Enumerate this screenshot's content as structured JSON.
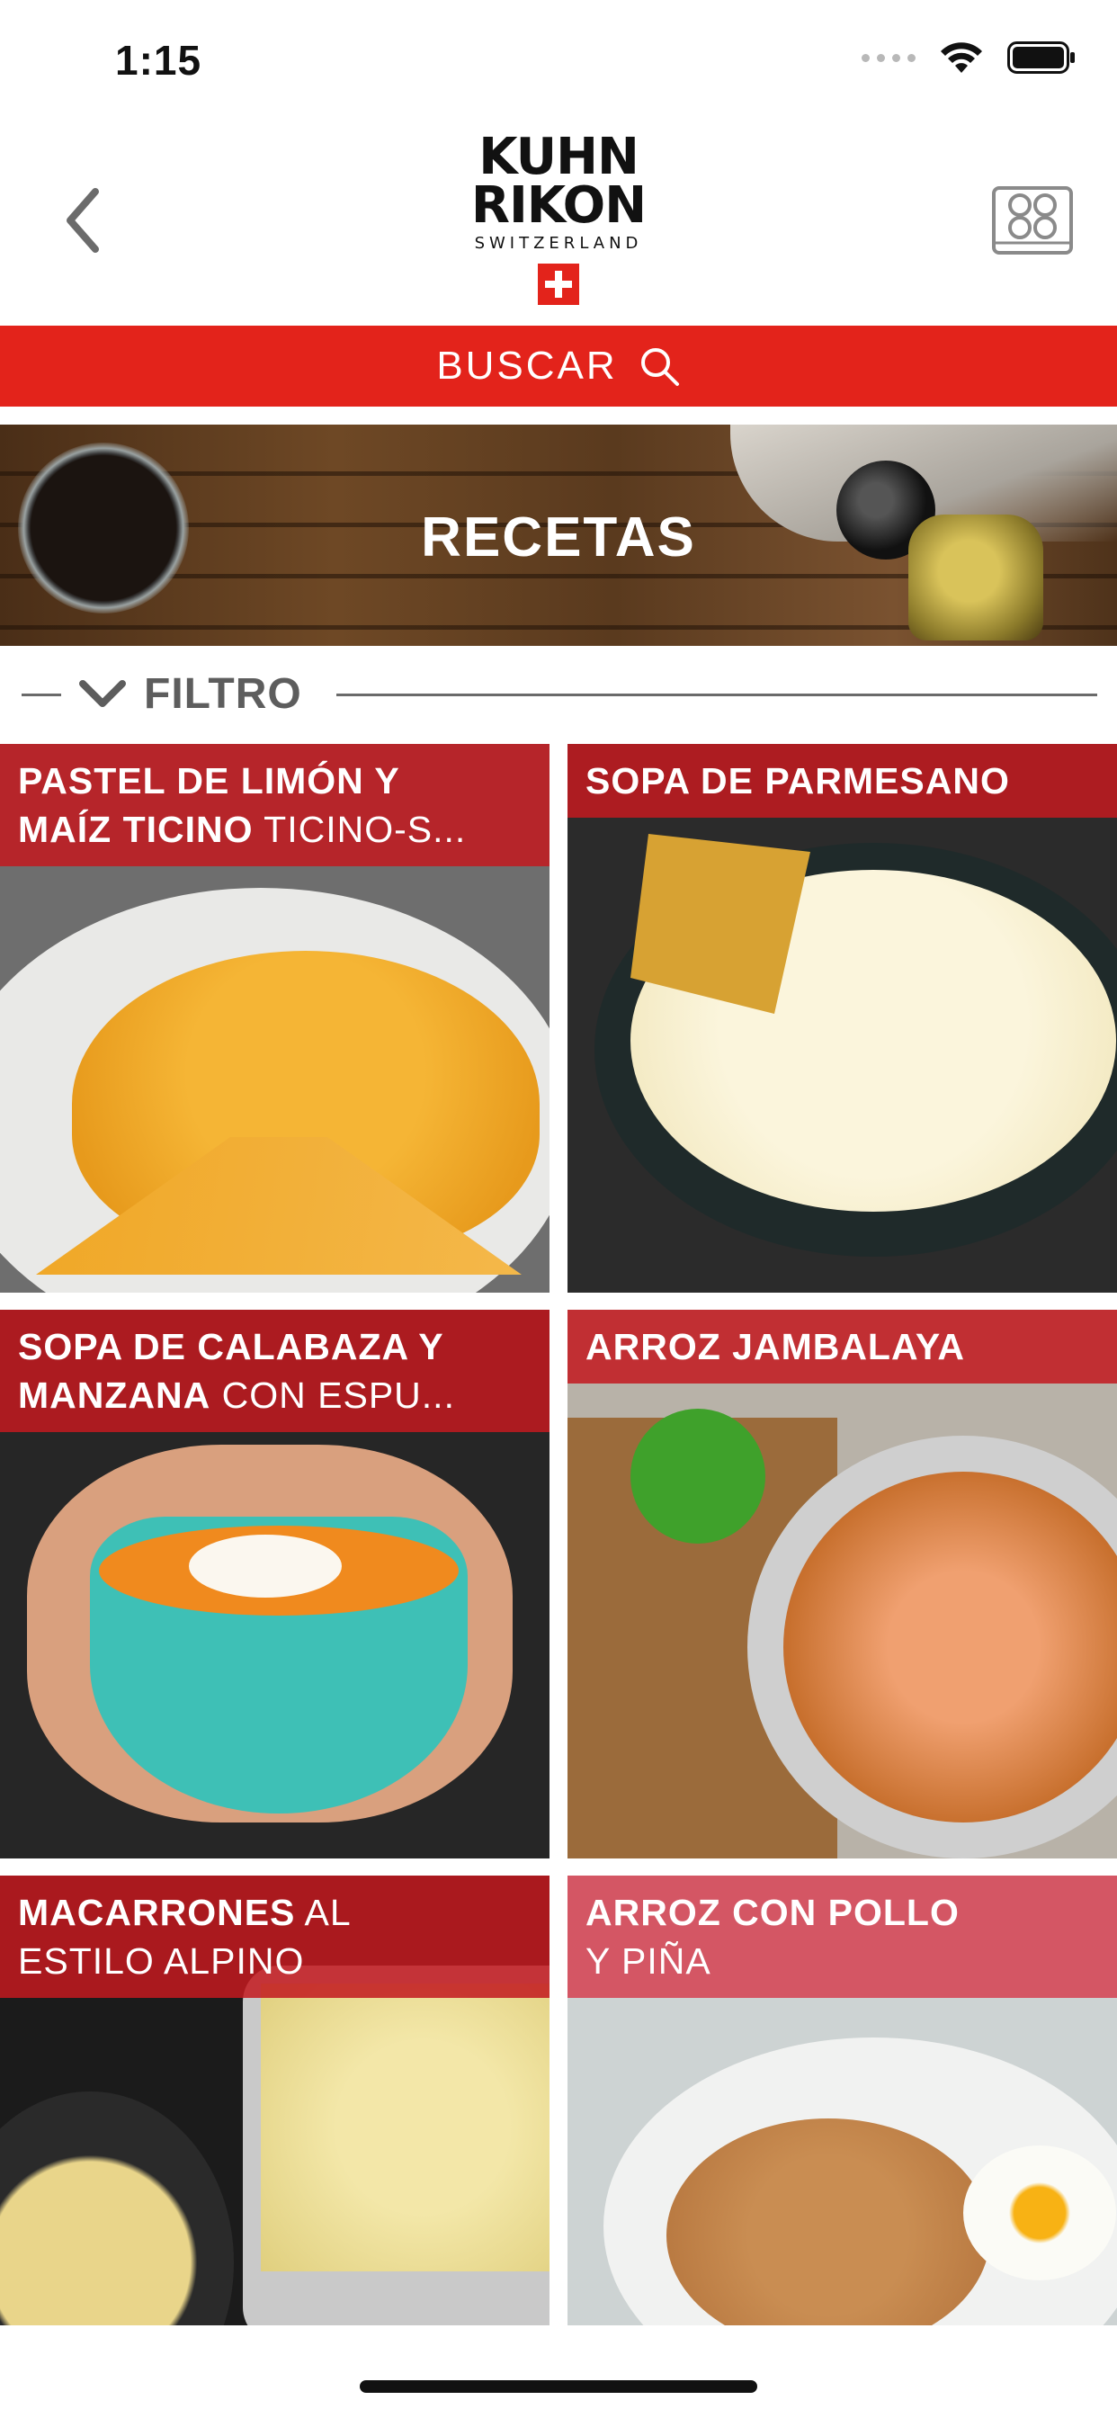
{
  "status_bar": {
    "time": "1:15",
    "icons": [
      "signal-dots-icon",
      "wifi-icon",
      "battery-icon"
    ]
  },
  "header": {
    "back_icon": "chevron-left-icon",
    "logo": {
      "line1": "KUHN",
      "line2": "RIKON",
      "line3": "SWITZERLAND"
    },
    "right_icon": "cooktop-icon"
  },
  "search": {
    "label": "BUSCAR",
    "icon": "search-icon"
  },
  "banner": {
    "title": "RECETAS"
  },
  "filter": {
    "label": "FILTRO",
    "icon": "chevron-down-icon"
  },
  "recipes": [
    {
      "title_bold_1": "PASTEL DE LIMÓN Y",
      "title_bold_2": "MAÍZ TICINO",
      "title_regular_2": " TICINO-S..."
    },
    {
      "title_bold_1": "SOPA DE PARMESANO"
    },
    {
      "title_bold_1": "SOPA DE CALABAZA Y",
      "title_bold_2": "MANZANA",
      "title_regular_2": " CON ESPU..."
    },
    {
      "title_bold_1": "ARROZ JAMBALAYA"
    },
    {
      "title_bold_1": "MACARRONES",
      "title_regular_1": " AL",
      "title_regular_2": "ESTILO ALPINO"
    },
    {
      "title_bold_1": "ARROZ CON POLLO",
      "title_regular_2": "Y PIÑA"
    }
  ],
  "colors": {
    "brand_red": "#e3231b",
    "caption_red": "#c21a20",
    "filter_gray": "#5d5d5d"
  }
}
